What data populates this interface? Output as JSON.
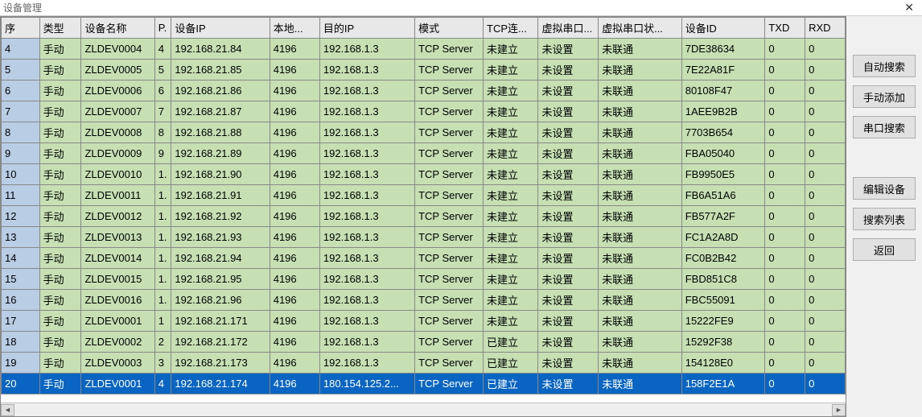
{
  "window": {
    "title": "设备管理"
  },
  "columns": [
    "序",
    "类型",
    "设备名称",
    "P.",
    "设备IP",
    "本地...",
    "目的IP",
    "模式",
    "TCP连...",
    "虚拟串口...",
    "虚拟串口状...",
    "设备ID",
    "TXD",
    "RXD"
  ],
  "buttons": {
    "auto_search": "自动搜索",
    "manual_add": "手动添加",
    "serial_search": "串口搜索",
    "edit_device": "编辑设备",
    "search_list": "搜索列表",
    "back": "返回"
  },
  "rows": [
    {
      "seq": "4",
      "type": "手动",
      "name": "ZLDEV0004",
      "p": "4",
      "ip": "192.168.21.84",
      "lport": "4196",
      "dip": "192.168.1.3",
      "mode": "TCP Server",
      "tcp": "未建立",
      "vcom": "未设置",
      "vstat": "未联通",
      "devid": "7DE38634",
      "txd": "0",
      "rxd": "0",
      "sel": false
    },
    {
      "seq": "5",
      "type": "手动",
      "name": "ZLDEV0005",
      "p": "5",
      "ip": "192.168.21.85",
      "lport": "4196",
      "dip": "192.168.1.3",
      "mode": "TCP Server",
      "tcp": "未建立",
      "vcom": "未设置",
      "vstat": "未联通",
      "devid": "7E22A81F",
      "txd": "0",
      "rxd": "0",
      "sel": false
    },
    {
      "seq": "6",
      "type": "手动",
      "name": "ZLDEV0006",
      "p": "6",
      "ip": "192.168.21.86",
      "lport": "4196",
      "dip": "192.168.1.3",
      "mode": "TCP Server",
      "tcp": "未建立",
      "vcom": "未设置",
      "vstat": "未联通",
      "devid": "80108F47",
      "txd": "0",
      "rxd": "0",
      "sel": false
    },
    {
      "seq": "7",
      "type": "手动",
      "name": "ZLDEV0007",
      "p": "7",
      "ip": "192.168.21.87",
      "lport": "4196",
      "dip": "192.168.1.3",
      "mode": "TCP Server",
      "tcp": "未建立",
      "vcom": "未设置",
      "vstat": "未联通",
      "devid": "1AEE9B2B",
      "txd": "0",
      "rxd": "0",
      "sel": false
    },
    {
      "seq": "8",
      "type": "手动",
      "name": "ZLDEV0008",
      "p": "8",
      "ip": "192.168.21.88",
      "lport": "4196",
      "dip": "192.168.1.3",
      "mode": "TCP Server",
      "tcp": "未建立",
      "vcom": "未设置",
      "vstat": "未联通",
      "devid": "7703B654",
      "txd": "0",
      "rxd": "0",
      "sel": false
    },
    {
      "seq": "9",
      "type": "手动",
      "name": "ZLDEV0009",
      "p": "9",
      "ip": "192.168.21.89",
      "lport": "4196",
      "dip": "192.168.1.3",
      "mode": "TCP Server",
      "tcp": "未建立",
      "vcom": "未设置",
      "vstat": "未联通",
      "devid": "FBA05040",
      "txd": "0",
      "rxd": "0",
      "sel": false
    },
    {
      "seq": "10",
      "type": "手动",
      "name": "ZLDEV0010",
      "p": "1.",
      "ip": "192.168.21.90",
      "lport": "4196",
      "dip": "192.168.1.3",
      "mode": "TCP Server",
      "tcp": "未建立",
      "vcom": "未设置",
      "vstat": "未联通",
      "devid": "FB9950E5",
      "txd": "0",
      "rxd": "0",
      "sel": false
    },
    {
      "seq": "11",
      "type": "手动",
      "name": "ZLDEV0011",
      "p": "1.",
      "ip": "192.168.21.91",
      "lport": "4196",
      "dip": "192.168.1.3",
      "mode": "TCP Server",
      "tcp": "未建立",
      "vcom": "未设置",
      "vstat": "未联通",
      "devid": "FB6A51A6",
      "txd": "0",
      "rxd": "0",
      "sel": false
    },
    {
      "seq": "12",
      "type": "手动",
      "name": "ZLDEV0012",
      "p": "1.",
      "ip": "192.168.21.92",
      "lport": "4196",
      "dip": "192.168.1.3",
      "mode": "TCP Server",
      "tcp": "未建立",
      "vcom": "未设置",
      "vstat": "未联通",
      "devid": "FB577A2F",
      "txd": "0",
      "rxd": "0",
      "sel": false
    },
    {
      "seq": "13",
      "type": "手动",
      "name": "ZLDEV0013",
      "p": "1.",
      "ip": "192.168.21.93",
      "lport": "4196",
      "dip": "192.168.1.3",
      "mode": "TCP Server",
      "tcp": "未建立",
      "vcom": "未设置",
      "vstat": "未联通",
      "devid": "FC1A2A8D",
      "txd": "0",
      "rxd": "0",
      "sel": false
    },
    {
      "seq": "14",
      "type": "手动",
      "name": "ZLDEV0014",
      "p": "1.",
      "ip": "192.168.21.94",
      "lport": "4196",
      "dip": "192.168.1.3",
      "mode": "TCP Server",
      "tcp": "未建立",
      "vcom": "未设置",
      "vstat": "未联通",
      "devid": "FC0B2B42",
      "txd": "0",
      "rxd": "0",
      "sel": false
    },
    {
      "seq": "15",
      "type": "手动",
      "name": "ZLDEV0015",
      "p": "1.",
      "ip": "192.168.21.95",
      "lport": "4196",
      "dip": "192.168.1.3",
      "mode": "TCP Server",
      "tcp": "未建立",
      "vcom": "未设置",
      "vstat": "未联通",
      "devid": "FBD851C8",
      "txd": "0",
      "rxd": "0",
      "sel": false
    },
    {
      "seq": "16",
      "type": "手动",
      "name": "ZLDEV0016",
      "p": "1.",
      "ip": "192.168.21.96",
      "lport": "4196",
      "dip": "192.168.1.3",
      "mode": "TCP Server",
      "tcp": "未建立",
      "vcom": "未设置",
      "vstat": "未联通",
      "devid": "FBC55091",
      "txd": "0",
      "rxd": "0",
      "sel": false
    },
    {
      "seq": "17",
      "type": "手动",
      "name": "ZLDEV0001",
      "p": "1",
      "ip": "192.168.21.171",
      "lport": "4196",
      "dip": "192.168.1.3",
      "mode": "TCP Server",
      "tcp": "未建立",
      "vcom": "未设置",
      "vstat": "未联通",
      "devid": "15222FE9",
      "txd": "0",
      "rxd": "0",
      "sel": false
    },
    {
      "seq": "18",
      "type": "手动",
      "name": "ZLDEV0002",
      "p": "2",
      "ip": "192.168.21.172",
      "lport": "4196",
      "dip": "192.168.1.3",
      "mode": "TCP Server",
      "tcp": "已建立",
      "vcom": "未设置",
      "vstat": "未联通",
      "devid": "15292F38",
      "txd": "0",
      "rxd": "0",
      "sel": false
    },
    {
      "seq": "19",
      "type": "手动",
      "name": "ZLDEV0003",
      "p": "3",
      "ip": "192.168.21.173",
      "lport": "4196",
      "dip": "192.168.1.3",
      "mode": "TCP Server",
      "tcp": "已建立",
      "vcom": "未设置",
      "vstat": "未联通",
      "devid": "154128E0",
      "txd": "0",
      "rxd": "0",
      "sel": false
    },
    {
      "seq": "20",
      "type": "手动",
      "name": "ZLDEV0001",
      "p": "4",
      "ip": "192.168.21.174",
      "lport": "4196",
      "dip": "180.154.125.2...",
      "mode": "TCP Server",
      "tcp": "已建立",
      "vcom": "未设置",
      "vstat": "未联通",
      "devid": "158F2E1A",
      "txd": "0",
      "rxd": "0",
      "sel": true
    }
  ]
}
